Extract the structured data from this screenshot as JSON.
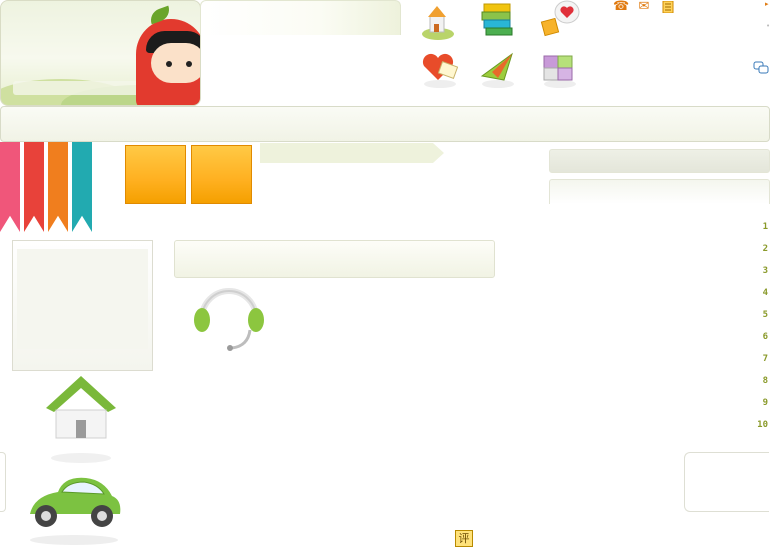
{
  "colors": {
    "ribbons": [
      "#f0567a",
      "#e8423a",
      "#f07e1e",
      "#22aab0"
    ],
    "accent_orange": "#ffb020",
    "accent_green": "#8ab020"
  },
  "feature_icons": [
    "house-building-icon",
    "books-icon",
    "heart-bubble-icon",
    "heart-letter-icon",
    "paper-plane-icon",
    "puzzle-icon"
  ],
  "top_links": [
    "phone-icon",
    "mail-icon",
    "notes-icon"
  ],
  "rank_numbers": [
    "1",
    "2",
    "3",
    "4",
    "5",
    "6",
    "7",
    "8",
    "9",
    "10"
  ],
  "eval_label": "评"
}
